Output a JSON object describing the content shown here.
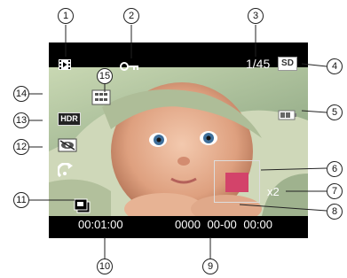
{
  "callouts": [
    "1",
    "2",
    "3",
    "4",
    "5",
    "6",
    "7",
    "8",
    "9",
    "10",
    "11",
    "12",
    "13",
    "14",
    "15"
  ],
  "status": {
    "file_counter": "1/45",
    "storage_label": "SD",
    "hdr_label": "HDR",
    "zoom_ratio": "x2",
    "duration": "00:01:00",
    "date_time": "0000 00-00 00:00"
  },
  "icons": [
    "playback-icon",
    "protect-key-icon",
    "sd-card-icon",
    "battery-icon",
    "dpof-icon",
    "hdr-icon",
    "red-eye-icon",
    "rotate-icon",
    "voice-memo-icon"
  ],
  "colors": {
    "zoom_region": "#d3436a",
    "screen_bg": "#000000"
  }
}
